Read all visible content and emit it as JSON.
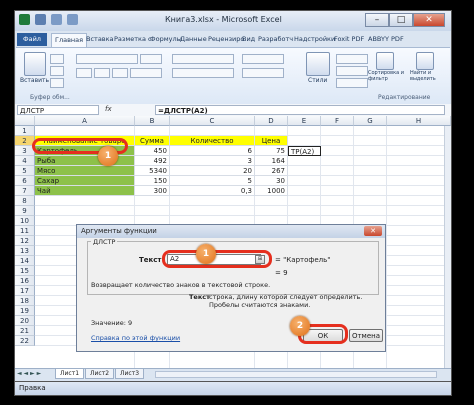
{
  "window": {
    "title": "Книга3.xlsx - Microsoft Excel",
    "min_label": "–",
    "max_label": "□",
    "close_label": "✕"
  },
  "ribbon_tabs": [
    "Файл",
    "Главная",
    "Вставка",
    "Разметка с",
    "Формулы",
    "Данные",
    "Рецензиро",
    "Вид",
    "Разработч",
    "Надстройки",
    "Foxit PDF",
    "ABBYY PDF"
  ],
  "ribbon": {
    "paste_label": "Вставить",
    "clipboard_label": "Буфер обм...",
    "styles_label": "Стили",
    "sort_label": "Сортировка и фильтр",
    "find_label": "Найти и выделить",
    "editing_label": "Редактирование"
  },
  "formula_bar": {
    "name_box": "ДЛСТР",
    "fx": "fx",
    "formula": "=ДЛСТР(A2)"
  },
  "grid": {
    "columns": [
      "A",
      "B",
      "C",
      "D",
      "E",
      "F",
      "G",
      "H"
    ],
    "rows": [
      "1",
      "2",
      "3",
      "4",
      "5",
      "6",
      "7",
      "8",
      "9",
      "10",
      "11",
      "12",
      "13",
      "14",
      "15",
      "16",
      "17",
      "18",
      "19",
      "20",
      "21",
      "22"
    ],
    "header": [
      "Наименование товара",
      "Сумма",
      "Количество",
      "Цена"
    ],
    "data": [
      [
        "Картофель",
        "450",
        "6",
        "75"
      ],
      [
        "Рыба",
        "492",
        "3",
        "164"
      ],
      [
        "Мясо",
        "5340",
        "20",
        "267"
      ],
      [
        "Сахар",
        "150",
        "5",
        "30"
      ],
      [
        "Чай",
        "300",
        "0,3",
        "1000"
      ]
    ],
    "e2_text": "ТР(A2)"
  },
  "dialog": {
    "title": "Аргументы функции",
    "func_name": "ДЛСТР",
    "arg_label": "Текст",
    "arg_value": "A2",
    "arg_result": "= \"Картофель\"",
    "total_result": "= 9",
    "description": "Возвращает количество знаков в текстовой строке.",
    "arg_desc_label": "Текст",
    "arg_desc": "строка, длину которой следует определить. Пробелы считаются знаками.",
    "value_text": "Значение: 9",
    "help_link": "Справка по этой функции",
    "ok_label": "ОК",
    "cancel_label": "Отмена"
  },
  "markers": [
    "1",
    "1",
    "2"
  ],
  "sheets": [
    "Лист1",
    "Лист2",
    "Лист3"
  ],
  "status": {
    "mode": "Правка"
  },
  "colors": {
    "header_fill": "#ffff00",
    "name_fill": "#8dc14a",
    "marker": "#e07018",
    "highlight_ring": "#e52f1e"
  }
}
